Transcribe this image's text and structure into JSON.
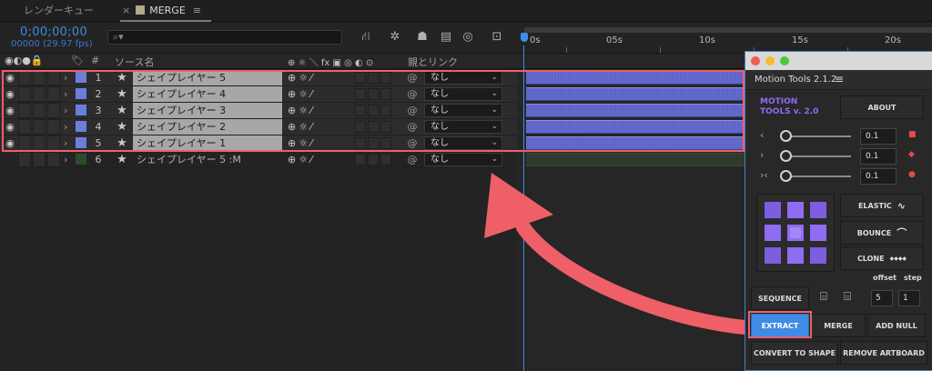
{
  "tabs": {
    "render_queue": "レンダーキュー",
    "merge": "MERGE",
    "close_glyph": "×",
    "menu_glyph": "≡"
  },
  "controls": {
    "timecode": "0;00;00;00",
    "frame_fps": "00000 (29.97 fps)",
    "search_placeholder": "",
    "search_icon": "🔎"
  },
  "ruler": {
    "labels": [
      "0s",
      "05s",
      "10s",
      "15s",
      "20s"
    ]
  },
  "columns": {
    "number": "#",
    "source_name": "ソース名",
    "switches": "⊕ ☼ ＼ fx ▣ ◎ ◐ ⊙",
    "parent_link": "親とリンク"
  },
  "layers": [
    {
      "num": "1",
      "name": "シェイプレイヤー 5",
      "parent": "なし",
      "selected": true,
      "color": "#6b7fd8"
    },
    {
      "num": "2",
      "name": "シェイプレイヤー 4",
      "parent": "なし",
      "selected": true,
      "color": "#6b7fd8"
    },
    {
      "num": "3",
      "name": "シェイプレイヤー 3",
      "parent": "なし",
      "selected": true,
      "color": "#6b7fd8"
    },
    {
      "num": "4",
      "name": "シェイプレイヤー 2",
      "parent": "なし",
      "selected": true,
      "color": "#6b7fd8"
    },
    {
      "num": "5",
      "name": "シェイプレイヤー 1",
      "parent": "なし",
      "selected": true,
      "color": "#6b7fd8"
    },
    {
      "num": "6",
      "name": "シェイプレイヤー 5 :M",
      "parent": "なし",
      "selected": false,
      "color": "#2e4a2c"
    }
  ],
  "panel": {
    "title": "Motion Tools 2.1.2",
    "menu_glyph": "≡",
    "logo_line1": "MOTION",
    "logo_line2": "TOOLS v. 2.0",
    "about": "ABOUT",
    "sliders": [
      {
        "symbol": "‹",
        "value": "0.1",
        "marker": "■"
      },
      {
        "symbol": "›",
        "value": "0.1",
        "marker": "◆"
      },
      {
        "symbol": "›‹",
        "value": "0.1",
        "marker": "●"
      }
    ],
    "elastic": "ELASTIC",
    "bounce": "BOUNCE",
    "clone": "CLONE",
    "clone_glyph": "◆◆◆◆",
    "offset_label": "offset",
    "step_label": "step",
    "sequence": "SEQUENCE",
    "offset_value": "5",
    "step_value": "1",
    "extract": "EXTRACT",
    "merge": "MERGE",
    "add_null": "ADD NULL",
    "convert_to_shape": "CONVERT TO SHAPE",
    "remove_artboard": "REMOVE ARTBOARD"
  },
  "colors": {
    "accent_blue": "#3f8be6",
    "logo_purple": "#8f6cf2",
    "highlight_red": "#ef5f68",
    "layer_bar": "#5e65c9"
  }
}
